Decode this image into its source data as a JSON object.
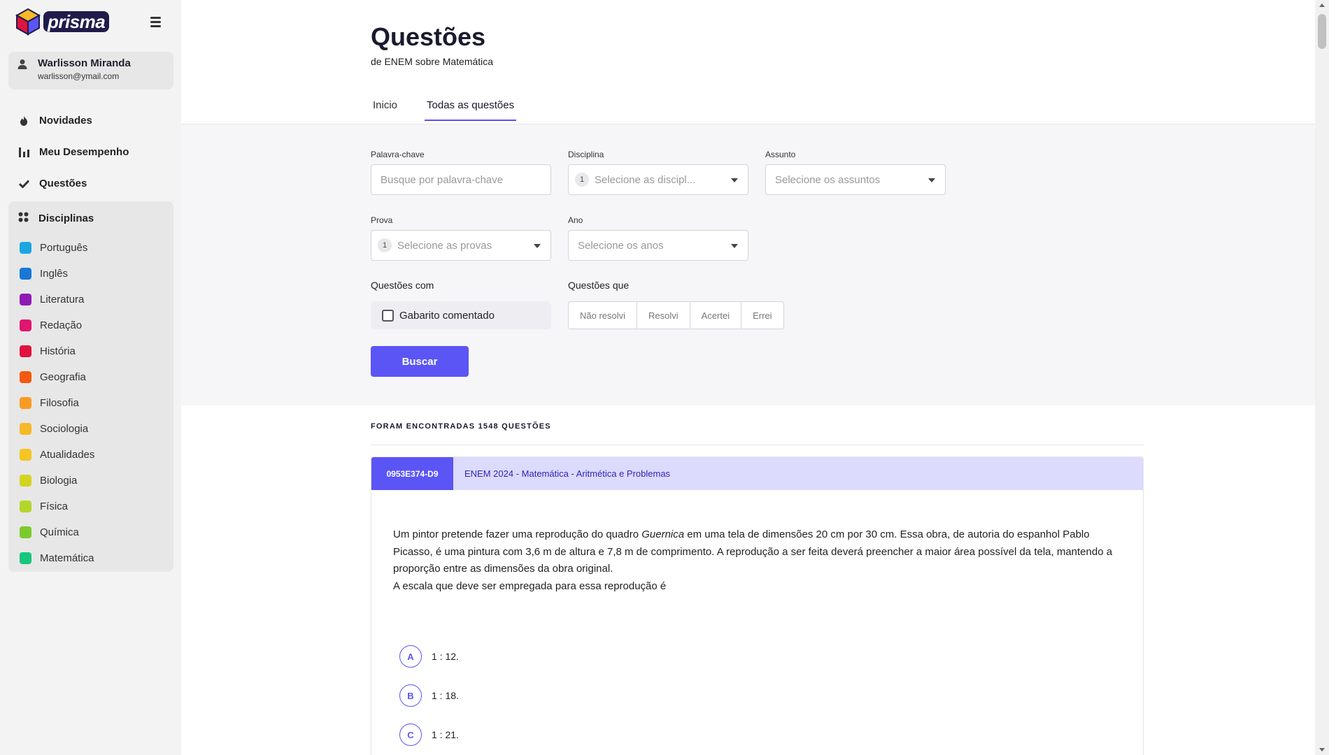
{
  "app": {
    "logo_text": "prisma",
    "logo_icon": "cube-logo-icon",
    "menu_icon": "hamburger-icon"
  },
  "user": {
    "name": "Warlisson Miranda",
    "email": "warlisson@ymail.com",
    "icon": "user-icon"
  },
  "nav": [
    {
      "label": "Novidades",
      "icon": "fire-icon"
    },
    {
      "label": "Meu Desempenho",
      "icon": "bar-chart-icon"
    },
    {
      "label": "Questões",
      "icon": "check-icon"
    }
  ],
  "disciplinas": {
    "title": "Disciplinas",
    "icon": "grid-dots-icon",
    "items": [
      {
        "label": "Português",
        "color": "#1aa7e0"
      },
      {
        "label": "Inglês",
        "color": "#1778d6"
      },
      {
        "label": "Literatura",
        "color": "#8e1ab5"
      },
      {
        "label": "Redação",
        "color": "#e0156f"
      },
      {
        "label": "História",
        "color": "#e0133d"
      },
      {
        "label": "Geografia",
        "color": "#f0590f"
      },
      {
        "label": "Filosofia",
        "color": "#f79b24"
      },
      {
        "label": "Sociologia",
        "color": "#f7b928"
      },
      {
        "label": "Atualidades",
        "color": "#f5c521"
      },
      {
        "label": "Biologia",
        "color": "#d4d420"
      },
      {
        "label": "Física",
        "color": "#b3d62a"
      },
      {
        "label": "Química",
        "color": "#7cc92c"
      },
      {
        "label": "Matemática",
        "color": "#18c77a"
      }
    ]
  },
  "page": {
    "title": "Questões",
    "subtitle": "de ENEM sobre Matemática",
    "tabs": [
      {
        "label": "Inicio",
        "active": false
      },
      {
        "label": "Todas as questões",
        "active": true
      }
    ]
  },
  "filters": {
    "keyword": {
      "label": "Palavra-chave",
      "placeholder": "Busque por palavra-chave"
    },
    "disciplina": {
      "label": "Disciplina",
      "count": "1",
      "placeholder": "Selecione as discipl..."
    },
    "assunto": {
      "label": "Assunto",
      "placeholder": "Selecione os assuntos"
    },
    "prova": {
      "label": "Prova",
      "count": "1",
      "placeholder": "Selecione as provas"
    },
    "ano": {
      "label": "Ano",
      "placeholder": "Selecione os anos"
    },
    "questoes_com": {
      "label": "Questões com",
      "checkbox_label": "Gabarito comentado"
    },
    "questoes_que": {
      "label": "Questões que",
      "options": [
        "Não resolvi",
        "Resolvi",
        "Acertei",
        "Errei"
      ]
    },
    "search_button": "Buscar"
  },
  "results": {
    "found_text": "FORAM ENCONTRADAS 1548 QUESTÕES",
    "question": {
      "id": "0953E374-D9",
      "source": "ENEM 2024 - Matemática - Aritmética e Problemas",
      "text_before": "Um pintor pretende fazer uma reprodução do quadro ",
      "text_em": "Guernica",
      "text_after": " em uma tela de dimensões 20 cm por 30 cm. Essa obra, de autoria do espanhol Pablo Picasso, é uma pintura com 3,6 m de altura e 7,8 m de comprimento. A reprodução a ser feita deverá preencher a maior área possível da tela, mantendo a proporção entre as dimensões da obra original.",
      "prompt": "A escala que deve ser empregada para essa reprodução é",
      "options": [
        {
          "letter": "A",
          "text": "1 : 12."
        },
        {
          "letter": "B",
          "text": "1 : 18."
        },
        {
          "letter": "C",
          "text": "1 : 21."
        }
      ]
    }
  },
  "colors": {
    "accent": "#5b55f5",
    "accent_light": "#dcdafd"
  }
}
